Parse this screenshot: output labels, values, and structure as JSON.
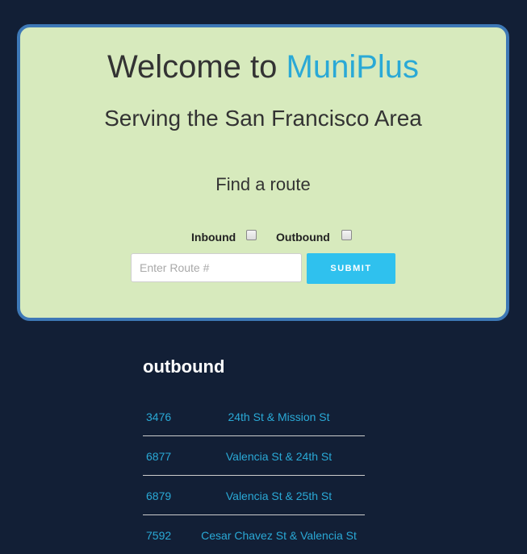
{
  "hero": {
    "welcome_prefix": "Welcome to",
    "brand": "MuniPlus",
    "subtitle": "Serving the San Francisco Area",
    "find_label": "Find a route"
  },
  "search": {
    "inbound_label": "Inbound",
    "outbound_label": "Outbound",
    "inbound_checked": false,
    "outbound_checked": false,
    "route_input_value": "",
    "route_input_placeholder": "Enter Route #",
    "submit_label": "SUBMIT"
  },
  "results": {
    "title": "outbound",
    "stops": [
      {
        "id": "3476",
        "name": "24th St & Mission St"
      },
      {
        "id": "6877",
        "name": "Valencia St & 24th St"
      },
      {
        "id": "6879",
        "name": "Valencia St & 25th St"
      },
      {
        "id": "7592",
        "name": "Cesar Chavez St & Valencia St"
      }
    ]
  },
  "colors": {
    "page_background": "#121f36",
    "hero_background": "#d7eabd",
    "hero_border": "#3d78b6",
    "brand_accent": "#2aa9d6",
    "submit_button": "#2fc1ee"
  }
}
